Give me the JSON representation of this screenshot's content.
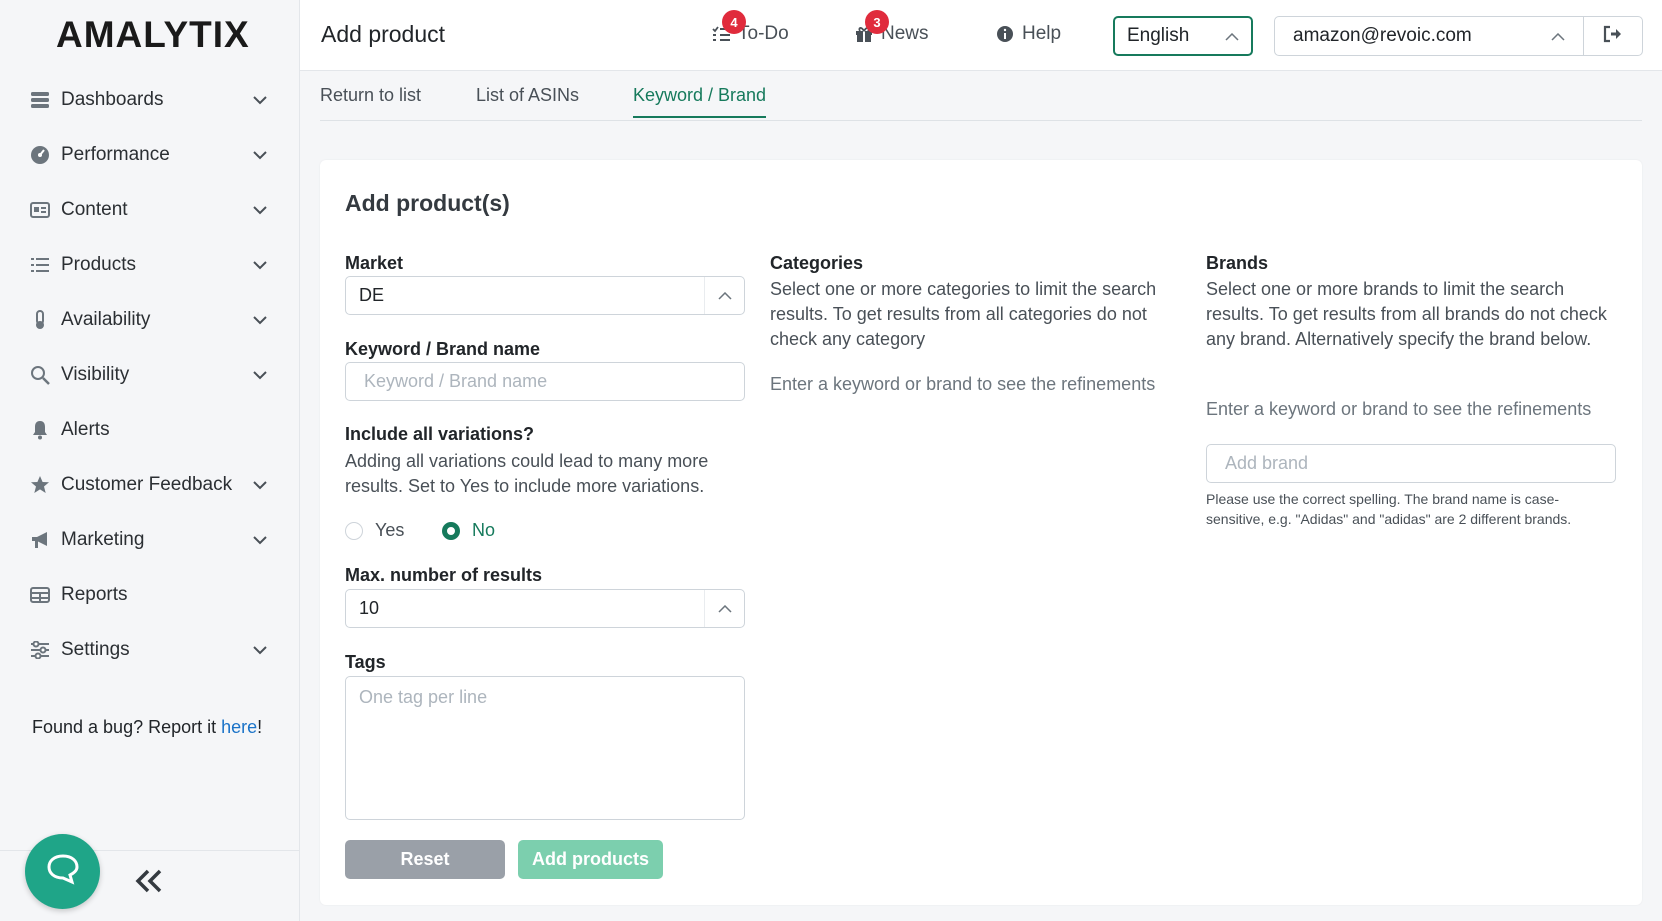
{
  "app": {
    "logo": "AMALYTIX"
  },
  "sidebar": {
    "items": [
      {
        "label": "Dashboards",
        "icon": "dashboard-icon",
        "chevron": true
      },
      {
        "label": "Performance",
        "icon": "gauge-icon",
        "chevron": true
      },
      {
        "label": "Content",
        "icon": "content-card-icon",
        "chevron": true
      },
      {
        "label": "Products",
        "icon": "list-icon",
        "chevron": true
      },
      {
        "label": "Availability",
        "icon": "thermometer-icon",
        "chevron": true
      },
      {
        "label": "Visibility",
        "icon": "magnifier-icon",
        "chevron": true
      },
      {
        "label": "Alerts",
        "icon": "bell-icon",
        "chevron": false
      },
      {
        "label": "Customer Feedback",
        "icon": "star-icon",
        "chevron": true
      },
      {
        "label": "Marketing",
        "icon": "megaphone-icon",
        "chevron": true
      },
      {
        "label": "Reports",
        "icon": "table-icon",
        "chevron": false
      },
      {
        "label": "Settings",
        "icon": "sliders-icon",
        "chevron": true
      }
    ],
    "bug_text": "Found a bug? Report it ",
    "bug_link": "here",
    "bug_suffix": "!"
  },
  "header": {
    "title": "Add product",
    "todo": {
      "label": "To-Do",
      "badge": "4"
    },
    "news": {
      "label": "News",
      "badge": "3"
    },
    "help": {
      "label": "Help"
    },
    "language": "English",
    "account": "amazon@revoic.com"
  },
  "tabs": [
    {
      "label": "Return to list",
      "active": false
    },
    {
      "label": "List of ASINs",
      "active": false
    },
    {
      "label": "Keyword / Brand",
      "active": true
    }
  ],
  "form": {
    "title": "Add product(s)",
    "market": {
      "label": "Market",
      "value": "DE"
    },
    "keyword": {
      "label": "Keyword / Brand name",
      "placeholder": "Keyword / Brand name"
    },
    "variations": {
      "label": "Include all variations?",
      "description": "Adding all variations could lead to many more results. Set to Yes to include more variations.",
      "yes": "Yes",
      "no": "No",
      "selected": "No"
    },
    "max_results": {
      "label": "Max. number of results",
      "value": "10"
    },
    "tags": {
      "label": "Tags",
      "placeholder": "One tag per line"
    },
    "reset_label": "Reset",
    "add_label": "Add products"
  },
  "categories": {
    "label": "Categories",
    "description": "Select one or more categories to limit the search results. To get results from all categories do not check any category",
    "empty": "Enter a keyword or brand to see the refinements"
  },
  "brands": {
    "label": "Brands",
    "description": "Select one or more brands to limit the search results. To get results from all brands do not check any brand. Alternatively specify the brand below.",
    "empty": "Enter a keyword or brand to see the refinements",
    "add_placeholder": "Add brand",
    "hint": "Please use the correct spelling. The brand name is case-sensitive, e.g. \"Adidas\" and \"adidas\" are 2 different brands."
  },
  "colors": {
    "accent": "#167a5c",
    "chat": "#1fa588",
    "badge": "#e02b3c"
  }
}
